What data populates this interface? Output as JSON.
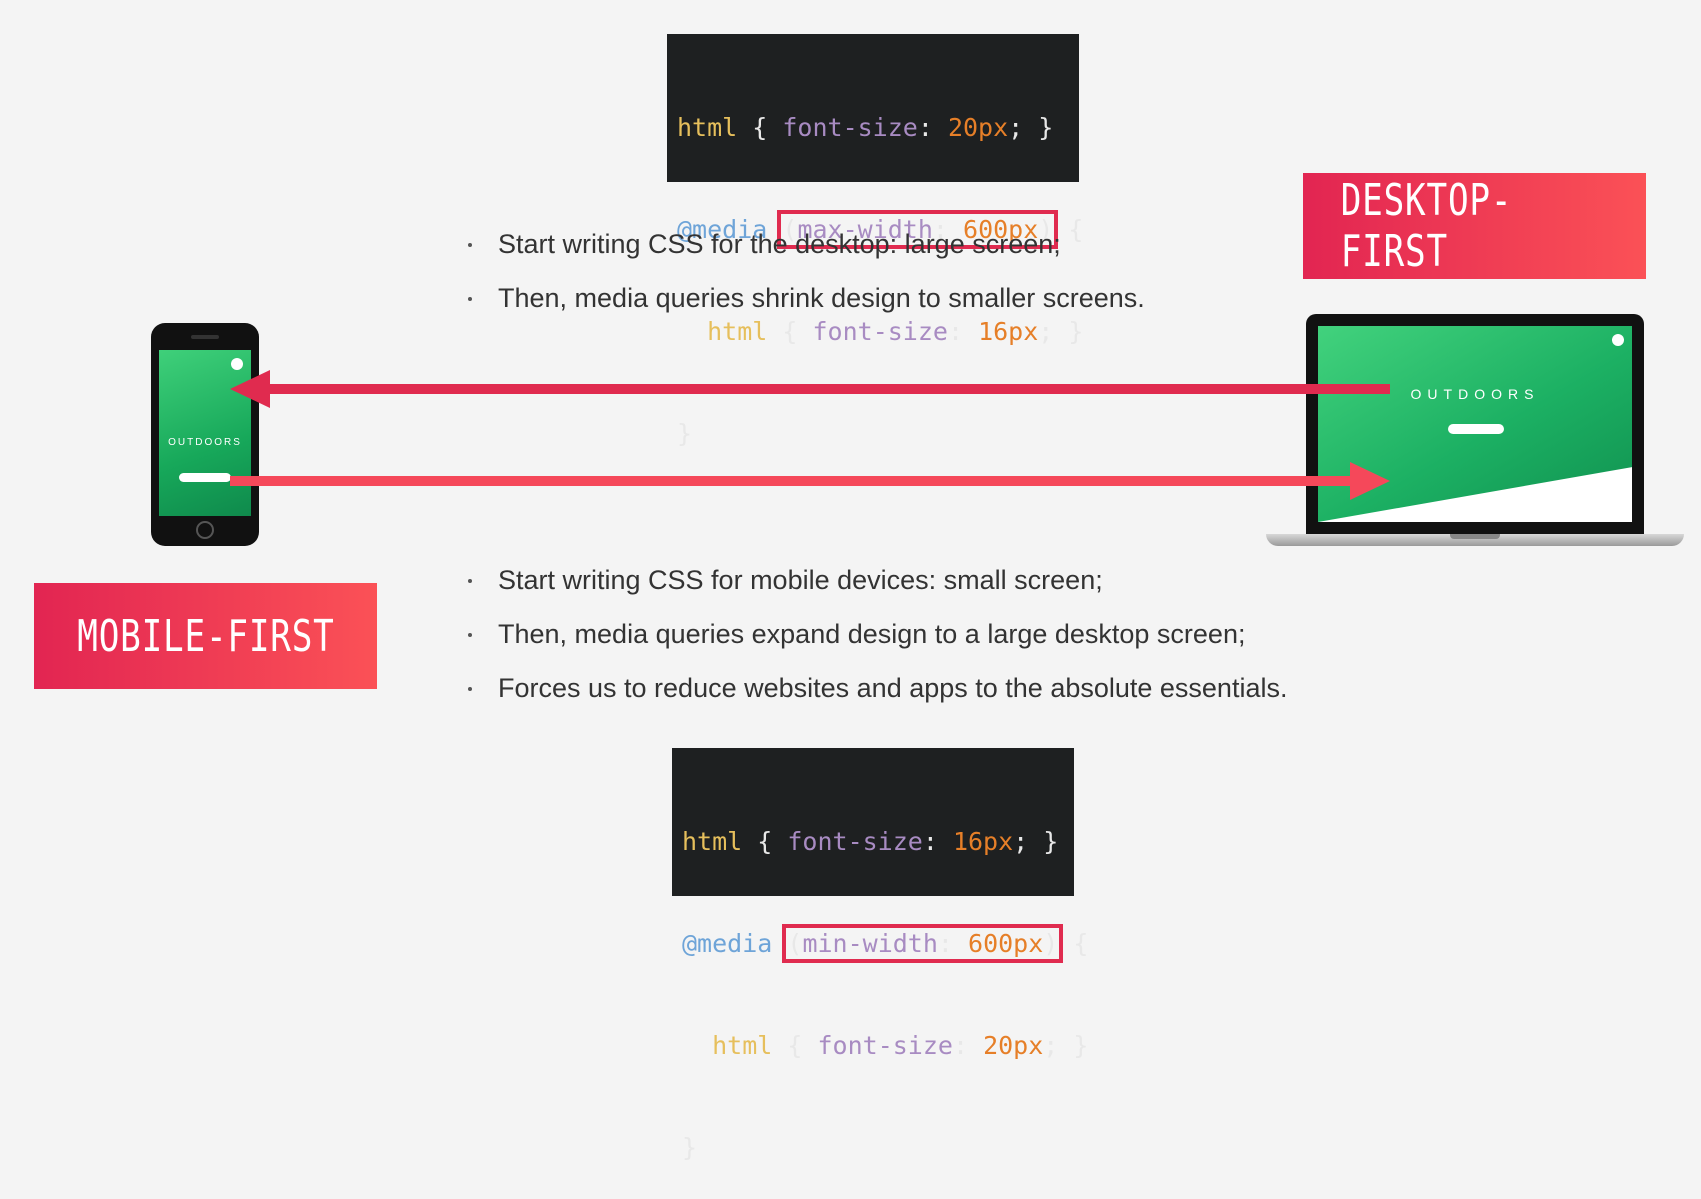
{
  "top_code": {
    "l1": {
      "sel": "html",
      "open": " { ",
      "prop": "font-size",
      "colon": ": ",
      "val": "20px",
      "end": "; }"
    },
    "l2": {
      "at": "@media",
      "sp": " ",
      "q_open": "(",
      "prop": "max-width",
      "colon": ": ",
      "val": "600px",
      "q_close": ")",
      "brace": " {"
    },
    "l3": {
      "indent": "  ",
      "sel": "html",
      "open": " { ",
      "prop": "font-size",
      "colon": ": ",
      "val": "16px",
      "end": "; }"
    },
    "l4": "}"
  },
  "bottom_code": {
    "l1": {
      "sel": "html",
      "open": " { ",
      "prop": "font-size",
      "colon": ": ",
      "val": "16px",
      "end": "; }"
    },
    "l2": {
      "at": "@media",
      "sp": " ",
      "q_open": "(",
      "prop": "min-width",
      "colon": ": ",
      "val": "600px",
      "q_close": ")",
      "brace": " {"
    },
    "l3": {
      "indent": "  ",
      "sel": "html",
      "open": " { ",
      "prop": "font-size",
      "colon": ": ",
      "val": "20px",
      "end": "; }"
    },
    "l4": "}"
  },
  "desktop_bullets": [
    "Start writing CSS for the desktop: large screen;",
    "Then, media queries shrink design to smaller screens."
  ],
  "mobile_bullets": [
    "Start writing CSS for mobile devices: small screen;",
    "Then, media queries expand design to a large desktop screen;",
    "Forces us to reduce websites and apps to the absolute essentials."
  ],
  "desktop_badge": "DESKTOP-FIRST",
  "mobile_badge": "MOBILE-FIRST",
  "phone_title": "OUTDOORS",
  "laptop_title": "OUTDOORS",
  "colors": {
    "background": "#f4f4f4",
    "badge_start": "#e22552",
    "badge_end": "#fb5156",
    "arrow_left": "#e02b4f",
    "arrow_right": "#f5485a",
    "highlight": "#e02b4f"
  },
  "icons": [
    "arrow-left-icon",
    "arrow-right-icon",
    "phone-mockup",
    "laptop-mockup",
    "menu-icon"
  ]
}
